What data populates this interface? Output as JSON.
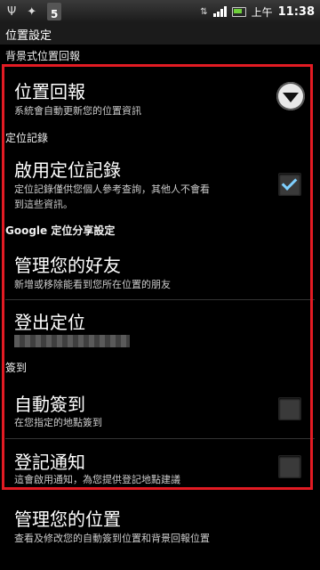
{
  "status_bar": {
    "usb_icon": "usb-icon",
    "android_icon": "android-debug-icon",
    "badge": "5",
    "ampm": "上午",
    "time": "11:38"
  },
  "window": {
    "title": "位置設定"
  },
  "sections": {
    "background_reporting_header": "背景式位置回報",
    "location_history_header": "定位記錄",
    "google_sharing_header": "Google 定位分享設定",
    "checkin_header": "簽到"
  },
  "items": {
    "location_reporting": {
      "title": "位置回報",
      "summary": "系統會自動更新您的位置資訊"
    },
    "enable_history": {
      "title": "啟用定位記錄",
      "summary_line1": "定位記錄僅供您個人參考查詢，其他人不會看",
      "summary_line2": "到這些資訊。",
      "checked": true
    },
    "manage_friends": {
      "title": "管理您的好友",
      "summary": "新增或移除能看到您所在位置的朋友"
    },
    "sign_out": {
      "title": "登出定位"
    },
    "auto_checkin": {
      "title": "自動簽到",
      "summary": "在您指定的地點簽到",
      "checked": false
    },
    "checkin_notifications": {
      "title": "登記通知",
      "summary": "這會啟用通知，為您提供登記地點建議",
      "checked": false
    },
    "manage_places": {
      "title": "管理您的位置",
      "summary": "查看及修改您的自動簽到位置和背景回報位置"
    }
  },
  "colors": {
    "highlight": "#e21b23",
    "check": "#7fd0ff"
  }
}
